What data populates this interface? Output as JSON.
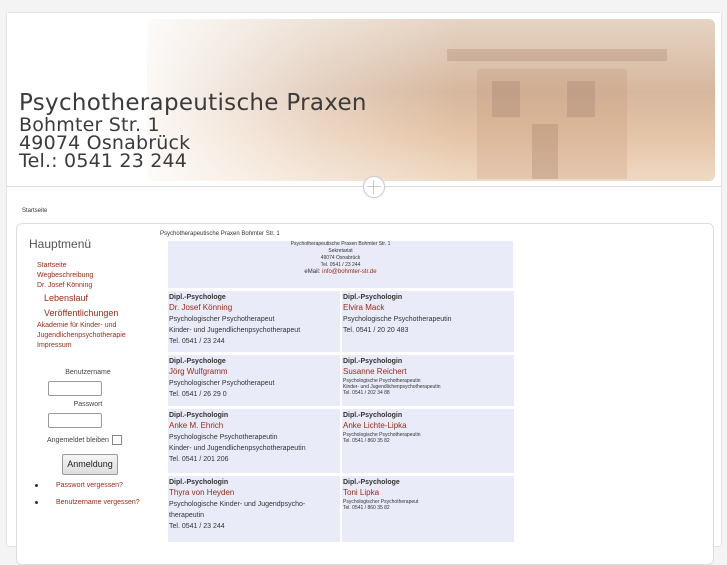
{
  "header": {
    "title": "Psychotherapeutische Praxen",
    "street": "Bohmter Str. 1",
    "city": "49074 Osnabrück",
    "phone": "Tel.: 0541 23 244"
  },
  "breadcrumb": "Startseite",
  "sidebar": {
    "menu_title": "Hauptmenü",
    "items": [
      {
        "label": "Startseite"
      },
      {
        "label": "Wegbeschreibung"
      },
      {
        "label": "Dr. Josef Könning"
      },
      {
        "label": "Lebenslauf"
      },
      {
        "label": "Veröffentlichungen"
      },
      {
        "label": "Akademie für Kinder- und"
      },
      {
        "label": "Jugendlichenpsychotherapie"
      },
      {
        "label": "Impressum"
      }
    ],
    "login": {
      "username_label": "Benutzername",
      "password_label": "Passwort",
      "remember_label": "Angemeldet bleiben",
      "submit_label": "Anmeldung",
      "forgot_password": "Passwort vergessen?",
      "forgot_username": "Benutzername vergessen?"
    }
  },
  "content": {
    "title": "Psychotherapeutische Praxen Bohmter Str. 1",
    "secretariat": {
      "line1": "Psychotherapeutische Praxen Bohmter Str. 1",
      "line2": "Sekretariat",
      "line3": "49074 Osnabrück",
      "line4": "Tel. 0541 / 23 244",
      "mail_prefix": "eMail:",
      "mail": "info@bohmter-str.de"
    },
    "people": [
      {
        "role": "Dipl.-Psychologe",
        "name": "Dr. Josef Könning",
        "desc1": "Psychologischer Psychotherapeut",
        "desc2": "Kinder- und Jugendlichenpsychotherapeut",
        "phone": "Tel. 0541 / 23 244"
      },
      {
        "role": "Dipl.-Psychologin",
        "name": "Elvira Mack",
        "desc1": "Psychologische Psychotherapeutin",
        "desc2": "",
        "phone": "Tel. 0541 / 20 20 483"
      },
      {
        "role": "Dipl.-Psychologe",
        "name": "Jörg Wulfgramm",
        "desc1": "Psychologischer Psychotherapeut",
        "desc2": "",
        "phone": "Tel. 0541 / 26 29 0"
      },
      {
        "role": "Dipl.-Psychologin",
        "name": "Susanne Reichert",
        "desc1": "Psychologische Psychotherapeutin",
        "desc2": "Kinder- und Jugendlichenpsychotherapeutin",
        "phone": "Tel. 0541 / 202 34 88"
      },
      {
        "role": "Dipl.-Psychologin",
        "name": "Anke M. Ehrich",
        "desc1": "Psychologische Psychotherapeutin",
        "desc2": "Kinder- und Jugendlichenpsychotherapeutin",
        "phone": "Tel. 0541 / 201 206"
      },
      {
        "role": "Dipl.-Psychologin",
        "name": "Anke Lichte-Lipka",
        "desc1": "Psychologische Psychotherapeutin",
        "desc2": "",
        "phone": "Tel. 0541 / 860 35 82"
      },
      {
        "role": "Dipl.-Psychologin",
        "name": "Thyra von Heyden",
        "desc1": "Psychologische Kinder- und Jugendpsycho-",
        "desc2": "therapeutin",
        "phone": "Tel. 0541 / 23 244"
      },
      {
        "role": "Dipl.-Psychologe",
        "name": "Toni Lipka",
        "desc1": "Psychologischer Psychotherapeut",
        "desc2": "",
        "phone": "Tel. 0541 / 860 35 82"
      }
    ]
  }
}
